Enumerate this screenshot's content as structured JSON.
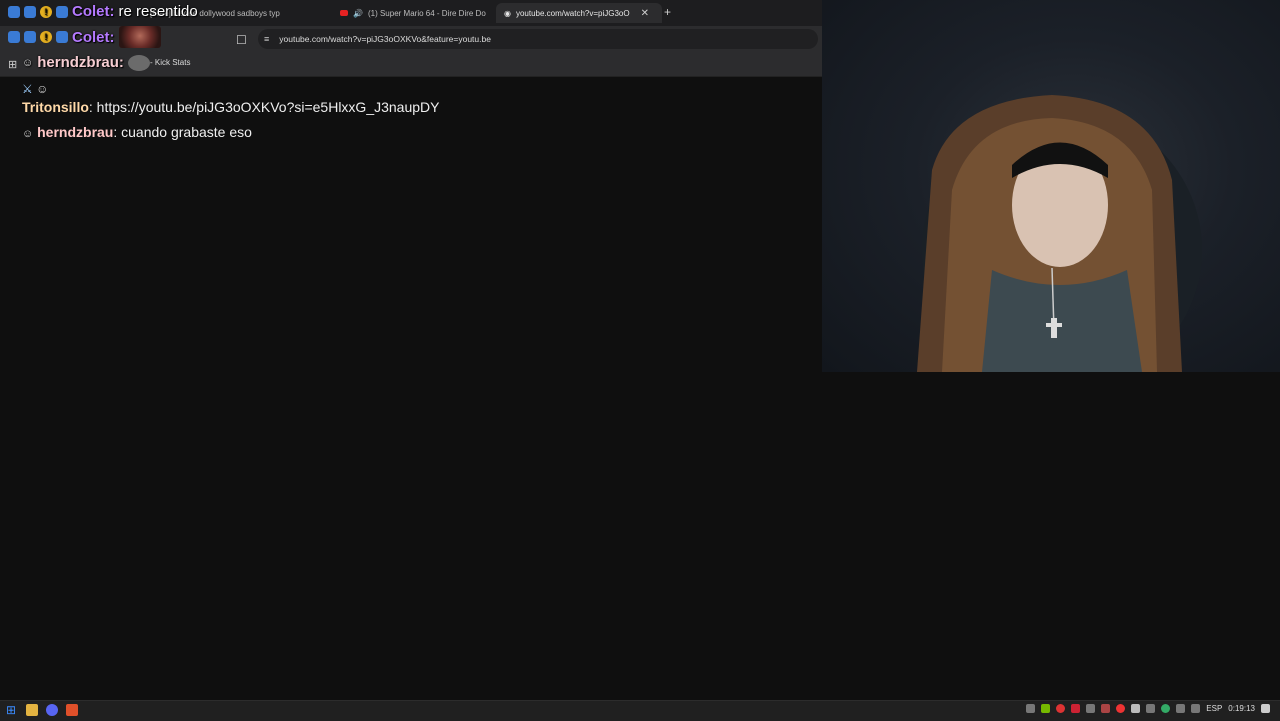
{
  "browser": {
    "tabs": [
      {
        "label": "[Free] bladee dollywood sadboys typ",
        "active": false
      },
      {
        "label": "(1) Super Mario 64 - Dire Dire Do",
        "active": false,
        "audio": true
      },
      {
        "label": "youtube.com/watch?v=piJG3oO",
        "active": true
      }
    ],
    "url": "youtube.com/watch?v=piJG3oOXKVo&feature=youtu.be",
    "bookmark_label": "- Kick Stats"
  },
  "overlay": {
    "line1_name": "Colet:",
    "line1_text": "re resentido",
    "line2_name": "Colet:",
    "line3_name": "herndzbrau:"
  },
  "chat": {
    "messages": [
      {
        "user": "Tritonsillo",
        "text": ": https://youtu.be/piJG3oOXKVo?si=e5HlxxG_J3naupDY"
      },
      {
        "user": "herndzbrau",
        "text": ": cuando grabaste eso"
      }
    ]
  },
  "taskbar": {
    "language": "ESP",
    "clock": "0:19:13"
  },
  "colors": {
    "background": "#0f0f0f",
    "name_purple": "#b57aff",
    "name_tritonsillo": "#ffd9a8",
    "name_herndzbrau": "#ffc8c8"
  }
}
